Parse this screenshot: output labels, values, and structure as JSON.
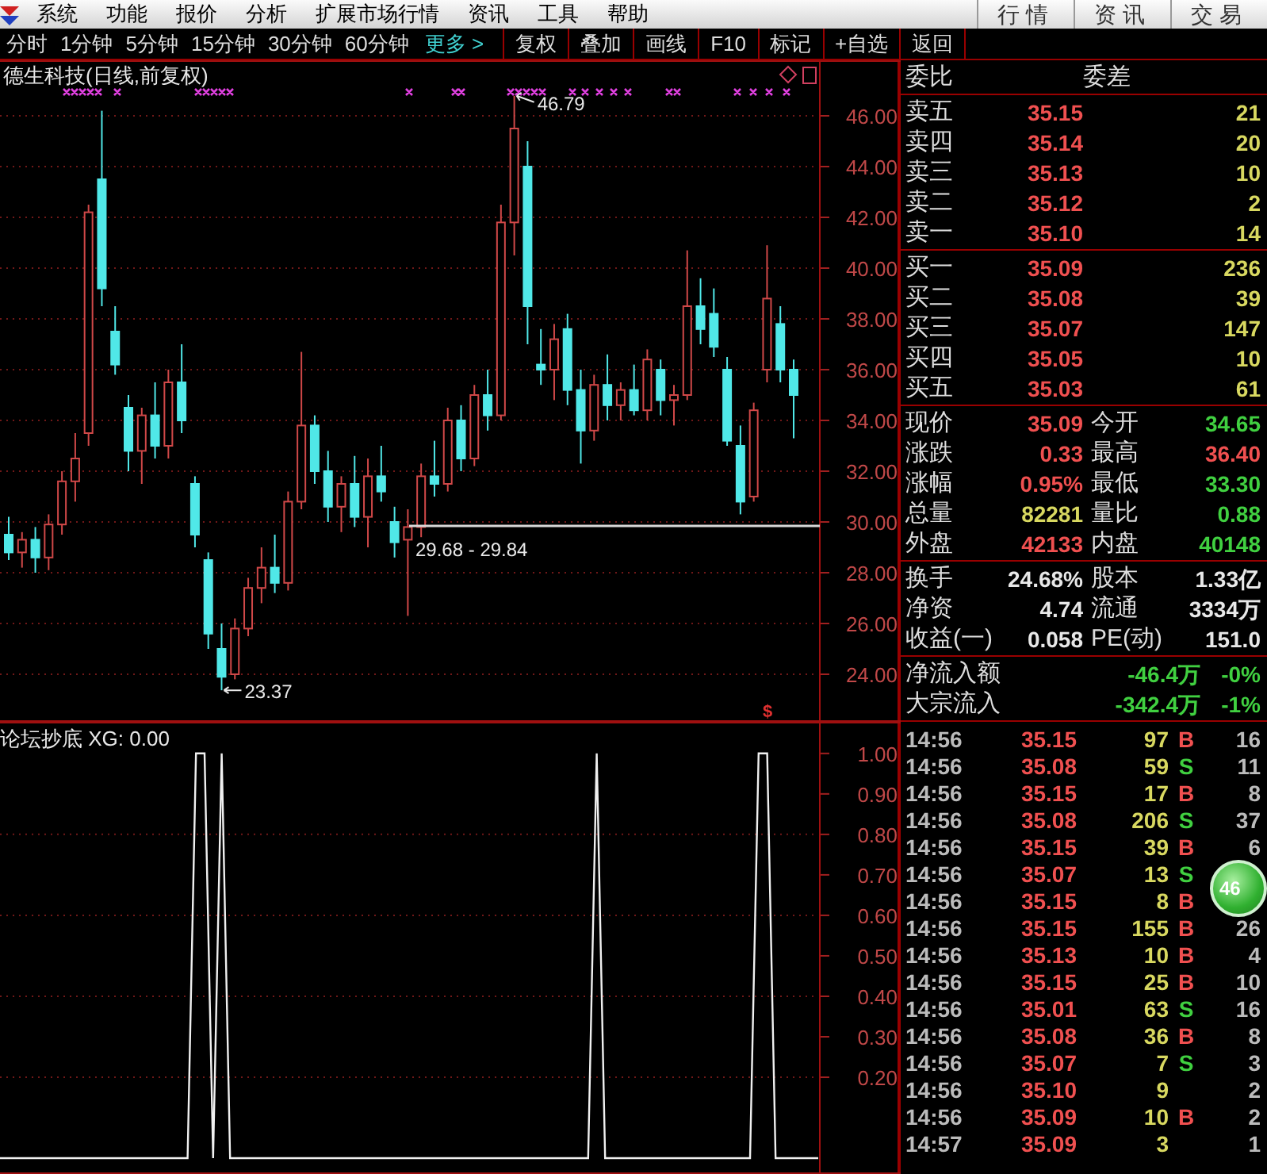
{
  "menu": {
    "items": [
      "系统",
      "功能",
      "报价",
      "分析",
      "扩展市场行情",
      "资讯",
      "工具",
      "帮助"
    ],
    "tabs": [
      "行情",
      "资讯",
      "交易"
    ]
  },
  "toolbar": {
    "periods": [
      "分时",
      "1分钟",
      "5分钟",
      "15分钟",
      "30分钟",
      "60分钟"
    ],
    "more": "更多 >",
    "buttons": [
      "复权",
      "叠加",
      "画线",
      "F10",
      "标记",
      "+自选",
      "返回"
    ]
  },
  "kline": {
    "title": "德生科技(日线,前复权)",
    "chart_data": {
      "type": "candlestick",
      "grid": true,
      "ylim": [
        22.125,
        48.1875
      ],
      "yticks": [
        {
          "value": 46,
          "label": "46.00"
        },
        {
          "value": 44,
          "label": "44.00"
        },
        {
          "value": 42,
          "label": "42.00"
        },
        {
          "value": 40,
          "label": "40.00"
        },
        {
          "value": 38,
          "label": "38.00"
        },
        {
          "value": 36,
          "label": "36.00"
        },
        {
          "value": 34,
          "label": "34.00"
        },
        {
          "value": 32,
          "label": "32.00"
        },
        {
          "value": 30,
          "label": "30.00"
        },
        {
          "value": 28,
          "label": "28.00"
        },
        {
          "value": 26,
          "label": "26.00"
        },
        {
          "value": 24,
          "label": "24.00"
        }
      ],
      "ohlc": [
        [
          29.5,
          30.2,
          28.5,
          28.8
        ],
        [
          28.8,
          29.6,
          28.2,
          29.3
        ],
        [
          29.3,
          29.8,
          28.0,
          28.6
        ],
        [
          28.6,
          30.3,
          28.1,
          29.9
        ],
        [
          29.9,
          32.0,
          29.5,
          31.6
        ],
        [
          31.6,
          33.5,
          30.8,
          32.5
        ],
        [
          33.5,
          42.5,
          33.0,
          42.2
        ],
        [
          43.5,
          46.2,
          38.5,
          39.2
        ],
        [
          37.5,
          38.5,
          35.8,
          36.2
        ],
        [
          34.5,
          35.0,
          32.0,
          32.8
        ],
        [
          32.8,
          34.5,
          31.5,
          34.2
        ],
        [
          34.2,
          35.5,
          32.5,
          33.0
        ],
        [
          33.0,
          36.0,
          32.5,
          35.5
        ],
        [
          35.5,
          37.0,
          33.5,
          34.0
        ],
        [
          31.5,
          31.8,
          29.0,
          29.5
        ],
        [
          28.5,
          28.8,
          25.0,
          25.6
        ],
        [
          25.0,
          26.0,
          23.37,
          23.9
        ],
        [
          24.0,
          26.2,
          23.8,
          25.8
        ],
        [
          25.8,
          27.8,
          25.5,
          27.4
        ],
        [
          27.4,
          29.0,
          26.8,
          28.2
        ],
        [
          28.2,
          29.5,
          27.2,
          27.6
        ],
        [
          27.6,
          31.2,
          27.3,
          30.8
        ],
        [
          30.8,
          36.7,
          30.5,
          33.8
        ],
        [
          33.8,
          34.2,
          31.5,
          32.0
        ],
        [
          32.0,
          32.8,
          30.0,
          30.6
        ],
        [
          30.6,
          31.8,
          29.6,
          31.5
        ],
        [
          31.5,
          32.6,
          29.8,
          30.2
        ],
        [
          30.2,
          32.5,
          29.0,
          31.8
        ],
        [
          31.8,
          33.0,
          30.8,
          31.2
        ],
        [
          30.0,
          30.6,
          28.6,
          29.2
        ],
        [
          29.3,
          30.5,
          26.3,
          29.8
        ],
        [
          29.8,
          32.3,
          29.4,
          31.8
        ],
        [
          31.8,
          33.2,
          31.0,
          31.5
        ],
        [
          31.5,
          34.5,
          31.2,
          34.0
        ],
        [
          34.0,
          34.6,
          32.0,
          32.5
        ],
        [
          32.5,
          35.4,
          32.2,
          35.0
        ],
        [
          35.0,
          36.0,
          33.6,
          34.2
        ],
        [
          34.2,
          42.5,
          34.0,
          41.8
        ],
        [
          41.8,
          46.79,
          40.5,
          45.5
        ],
        [
          44.0,
          45.0,
          37.0,
          38.5
        ],
        [
          36.2,
          37.6,
          35.4,
          36.0
        ],
        [
          36.0,
          37.8,
          34.8,
          37.2
        ],
        [
          37.6,
          38.2,
          34.6,
          35.2
        ],
        [
          35.2,
          36.0,
          32.3,
          33.6
        ],
        [
          33.6,
          35.8,
          33.2,
          35.4
        ],
        [
          35.4,
          36.6,
          34.0,
          34.6
        ],
        [
          34.6,
          35.5,
          34.0,
          35.2
        ],
        [
          35.2,
          36.2,
          34.2,
          34.4
        ],
        [
          34.4,
          36.8,
          34.0,
          36.4
        ],
        [
          36.0,
          36.4,
          34.2,
          34.8
        ],
        [
          34.8,
          35.4,
          33.8,
          35.0
        ],
        [
          35.0,
          40.7,
          34.8,
          38.5
        ],
        [
          38.5,
          39.6,
          37.0,
          37.6
        ],
        [
          38.2,
          39.2,
          36.5,
          36.9
        ],
        [
          36.0,
          36.5,
          33.0,
          33.2
        ],
        [
          33.0,
          33.8,
          30.3,
          30.8
        ],
        [
          31.0,
          34.7,
          30.8,
          34.4
        ],
        [
          36.0,
          40.9,
          35.5,
          38.8
        ],
        [
          37.8,
          38.5,
          35.5,
          36.0
        ],
        [
          36.0,
          36.4,
          33.3,
          35.0
        ]
      ]
    },
    "annotations": [
      {
        "kind": "high",
        "text": "46.79"
      },
      {
        "kind": "low",
        "text": "23.37"
      },
      {
        "kind": "range",
        "text": "29.68 - 29.84"
      }
    ],
    "marker": "$"
  },
  "indicator": {
    "title": "论坛抄底 XG: 0.00",
    "chart_data": {
      "type": "line",
      "grid": true,
      "ylim": [
        -0.039,
        1.078
      ],
      "yticks": [
        {
          "value": 1,
          "label": "1.00"
        },
        {
          "value": 0.9,
          "label": "0.90"
        },
        {
          "value": 0.8,
          "label": "0.80"
        },
        {
          "value": 0.7,
          "label": "0.70"
        },
        {
          "value": 0.6,
          "label": "0.60"
        },
        {
          "value": 0.5,
          "label": "0.50"
        },
        {
          "value": 0.4,
          "label": "0.40"
        },
        {
          "value": 0.3,
          "label": "0.30"
        },
        {
          "value": 0.2,
          "label": "0.20"
        }
      ],
      "series": [
        {
          "color": "#f0f0f0",
          "values": [
            0,
            0,
            0,
            0,
            0,
            0,
            0,
            0,
            0,
            0,
            0,
            0,
            0,
            0,
            0,
            0,
            0,
            0,
            0,
            0,
            0,
            0,
            0,
            1,
            1,
            0,
            1,
            0,
            0,
            0,
            0,
            0,
            0,
            0,
            0,
            0,
            0,
            0,
            0,
            0,
            0,
            0,
            0,
            0,
            0,
            0,
            0,
            0,
            0,
            0,
            0,
            0,
            0,
            0,
            0,
            0,
            0,
            0,
            0,
            0,
            0,
            0,
            0,
            0,
            0,
            0,
            0,
            0,
            0,
            0,
            1,
            0,
            0,
            0,
            0,
            0,
            0,
            0,
            0,
            0,
            0,
            0,
            0,
            0,
            0,
            0,
            0,
            0,
            0,
            1,
            1,
            0,
            0,
            0,
            0,
            0,
            0
          ]
        }
      ]
    }
  },
  "orderbook": {
    "header": [
      "委比",
      "委差"
    ],
    "asks": [
      {
        "label": "卖五",
        "price": "35.15",
        "volume": "21"
      },
      {
        "label": "卖四",
        "price": "35.14",
        "volume": "20"
      },
      {
        "label": "卖三",
        "price": "35.13",
        "volume": "10"
      },
      {
        "label": "卖二",
        "price": "35.12",
        "volume": "2"
      },
      {
        "label": "卖一",
        "price": "35.10",
        "volume": "14"
      }
    ],
    "bids": [
      {
        "label": "买一",
        "price": "35.09",
        "volume": "236"
      },
      {
        "label": "买二",
        "price": "35.08",
        "volume": "39"
      },
      {
        "label": "买三",
        "price": "35.07",
        "volume": "147"
      },
      {
        "label": "买四",
        "price": "35.05",
        "volume": "10"
      },
      {
        "label": "买五",
        "price": "35.03",
        "volume": "61"
      }
    ]
  },
  "quote": [
    {
      "label": "现价",
      "value": "35.09",
      "color": "#f05050"
    },
    {
      "label": "今开",
      "value": "34.65",
      "color": "#40d040"
    },
    {
      "label": "涨跌",
      "value": "0.33",
      "color": "#f05050"
    },
    {
      "label": "最高",
      "value": "36.40",
      "color": "#f05050"
    },
    {
      "label": "涨幅",
      "value": "0.95%",
      "color": "#f05050"
    },
    {
      "label": "最低",
      "value": "33.30",
      "color": "#40d040"
    },
    {
      "label": "总量",
      "value": "82281",
      "color": "#d8d860"
    },
    {
      "label": "量比",
      "value": "0.88",
      "color": "#40d040"
    },
    {
      "label": "外盘",
      "value": "42133",
      "color": "#f05050"
    },
    {
      "label": "内盘",
      "value": "40148",
      "color": "#40d040"
    }
  ],
  "stats": [
    {
      "label": "换手",
      "value": "24.68%",
      "label2": "股本",
      "value2": "1.33亿"
    },
    {
      "label": "净资",
      "value": "4.74",
      "label2": "流通",
      "value2": "3334万"
    },
    {
      "label": "收益(一)",
      "value": "0.058",
      "label2": "PE(动)",
      "value2": "151.0"
    }
  ],
  "flows": [
    {
      "label": "净流入额",
      "value": "-46.4万",
      "percent": "-0%"
    },
    {
      "label": "大宗流入",
      "value": "-342.4万",
      "percent": "-1%"
    }
  ],
  "ticks": [
    {
      "time": "14:56",
      "price": "35.15",
      "volume": "97",
      "side": "B",
      "count": "16"
    },
    {
      "time": "14:56",
      "price": "35.08",
      "volume": "59",
      "side": "S",
      "count": "11"
    },
    {
      "time": "14:56",
      "price": "35.15",
      "volume": "17",
      "side": "B",
      "count": "8"
    },
    {
      "time": "14:56",
      "price": "35.08",
      "volume": "206",
      "side": "S",
      "count": "37"
    },
    {
      "time": "14:56",
      "price": "35.15",
      "volume": "39",
      "side": "B",
      "count": "6"
    },
    {
      "time": "14:56",
      "price": "35.07",
      "volume": "13",
      "side": "S"
    },
    {
      "time": "14:56",
      "price": "35.15",
      "volume": "8",
      "side": "B"
    },
    {
      "time": "14:56",
      "price": "35.15",
      "volume": "155",
      "side": "B",
      "count": "26"
    },
    {
      "time": "14:56",
      "price": "35.13",
      "volume": "10",
      "side": "B",
      "count": "4"
    },
    {
      "time": "14:56",
      "price": "35.15",
      "volume": "25",
      "side": "B",
      "count": "10"
    },
    {
      "time": "14:56",
      "price": "35.01",
      "volume": "63",
      "side": "S",
      "count": "16"
    },
    {
      "time": "14:56",
      "price": "35.08",
      "volume": "36",
      "side": "B",
      "count": "8"
    },
    {
      "time": "14:56",
      "price": "35.07",
      "volume": "7",
      "side": "S",
      "count": "3"
    },
    {
      "time": "14:56",
      "price": "35.10",
      "volume": "9",
      "count": "2"
    },
    {
      "time": "14:56",
      "price": "35.09",
      "volume": "10",
      "side": "B",
      "count": "2"
    },
    {
      "time": "14:57",
      "price": "35.09",
      "volume": "3",
      "count": "1"
    }
  ],
  "float_ball": "46"
}
